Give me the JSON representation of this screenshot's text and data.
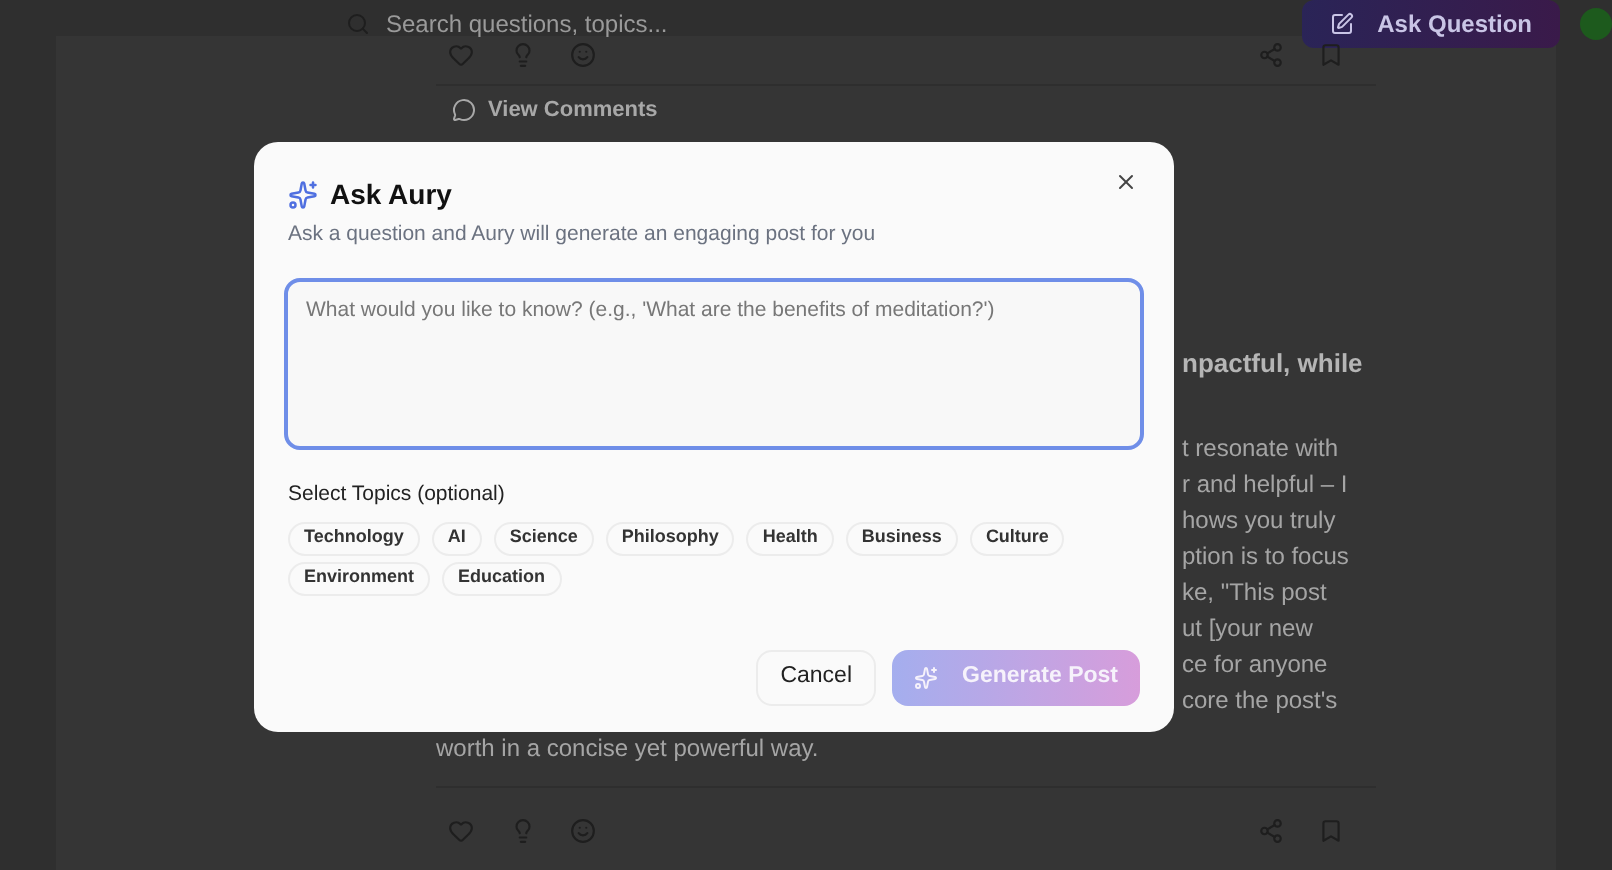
{
  "background": {
    "search": {
      "placeholder": "Search questions, topics..."
    },
    "ask_button": "Ask Question",
    "comments_link": "View Comments",
    "post_heading_fragment": "npactful, while",
    "post_line_fragments": [
      "t resonate with",
      "r and helpful – I",
      "hows you truly",
      "ption is to focus",
      "ke, \"This post",
      "ut [your new",
      "ce for anyone",
      "core the post's"
    ],
    "post_last_line": "worth in a concise yet powerful way."
  },
  "dialog": {
    "title": "Ask Aury",
    "subtitle": "Ask a question and Aury will generate an engaging post for you",
    "question": {
      "placeholder": "What would you like to know? (e.g., 'What are the benefits of meditation?')"
    },
    "topics_label": "Select Topics (optional)",
    "topics": [
      {
        "label": "Technology",
        "selected": false
      },
      {
        "label": "AI",
        "selected": false
      },
      {
        "label": "Science",
        "selected": false
      },
      {
        "label": "Philosophy",
        "selected": false
      },
      {
        "label": "Health",
        "selected": false
      },
      {
        "label": "Business",
        "selected": false
      },
      {
        "label": "Culture",
        "selected": false
      },
      {
        "label": "Environment",
        "selected": false
      },
      {
        "label": "Education",
        "selected": false
      }
    ],
    "cancel": "Cancel",
    "generate": {
      "label": "Generate Post",
      "disabled": true
    }
  }
}
